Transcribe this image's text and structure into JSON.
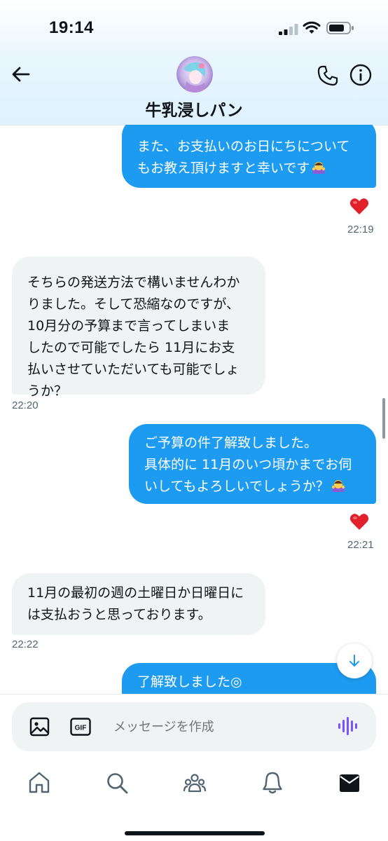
{
  "status_bar": {
    "time": "19:14"
  },
  "header": {
    "chat_name": "牛乳浸しパン"
  },
  "messages": [
    {
      "direction": "out",
      "lines": [
        "また、お支払いのお日にちについて",
        "もお教え頂けますと幸いです"
      ],
      "emoji": "bowing-person",
      "reaction": "heart",
      "time": "22:19"
    },
    {
      "direction": "in",
      "lines": [
        "そちらの発送方法で構いませんわか",
        "りました。そして恐縮なのですが、",
        "10月分の予算まで言ってしまいま",
        "したので可能でしたら 11月にお支",
        "払いさせていただいても可能でしょ",
        "うか？"
      ],
      "time": "22:20"
    },
    {
      "direction": "out",
      "lines": [
        "ご予算の件了解致しました。",
        "具体的に 11月のいつ頃かまでお伺",
        "いしてもよろしいでしょうか？"
      ],
      "emoji": "bowing-person",
      "reaction": "heart",
      "time": "22:21"
    },
    {
      "direction": "in",
      "lines": [
        "11月の最初の週の土曜日か日曜日に",
        "は支払おうと思っております。"
      ],
      "time": "22:22"
    },
    {
      "direction": "out",
      "lines": [
        "了解致しました◎"
      ]
    }
  ],
  "composer": {
    "placeholder": "メッセージを作成"
  },
  "colors": {
    "accent": "#1d9bf0",
    "incoming_bubble": "#eff3f4",
    "heart": "#f91880",
    "voice_icon": "#7856ff"
  },
  "tabs": [
    "home-icon",
    "search-icon",
    "communities-icon",
    "notifications-icon",
    "messages-icon"
  ]
}
